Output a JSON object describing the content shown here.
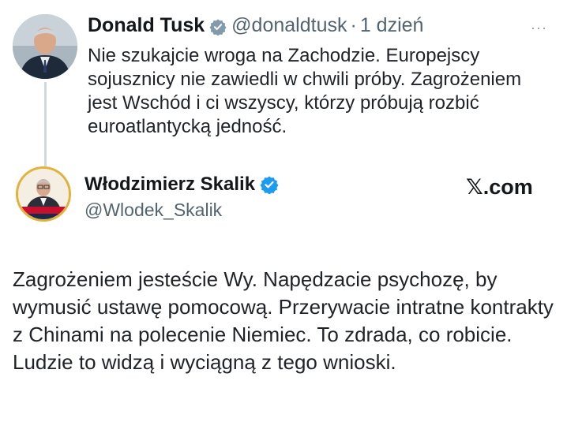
{
  "quoted_tweet": {
    "author_name": "Donald Tusk",
    "handle": "@donaldtusk",
    "separator": "·",
    "time": "1 dzień",
    "more_label": "···",
    "text": "Nie szukajcie wroga na Zachodzie. Europejscy sojusznicy nie zawiedli w chwili próby. Zagrożeniem jest Wschód i ci wszyscy, którzy próbują rozbić euroatlantycką jedność."
  },
  "reply_tweet": {
    "author_name": "Włodzimierz Skalik",
    "handle": "@Wlodek_Skalik",
    "text": "Zagrożeniem jesteście Wy. Napędzacie psychozę, by wymusić ustawę pomocową. Przerywacie intratne kontrakty z Chinami na polecenie Niemiec. To zdrada, co robicie. Ludzie to widzą i wyciągną z tego wnioski."
  },
  "watermark": {
    "label": "𝕏.com"
  },
  "colors": {
    "verified_gray": "#829aab",
    "verified_blue": "#1d9bf0",
    "thread_line": "#cfd9de",
    "secondary_text": "#536471"
  },
  "icons": {
    "verified_gray": "verified-gray-icon",
    "verified_blue": "verified-blue-icon",
    "more": "more-icon"
  }
}
